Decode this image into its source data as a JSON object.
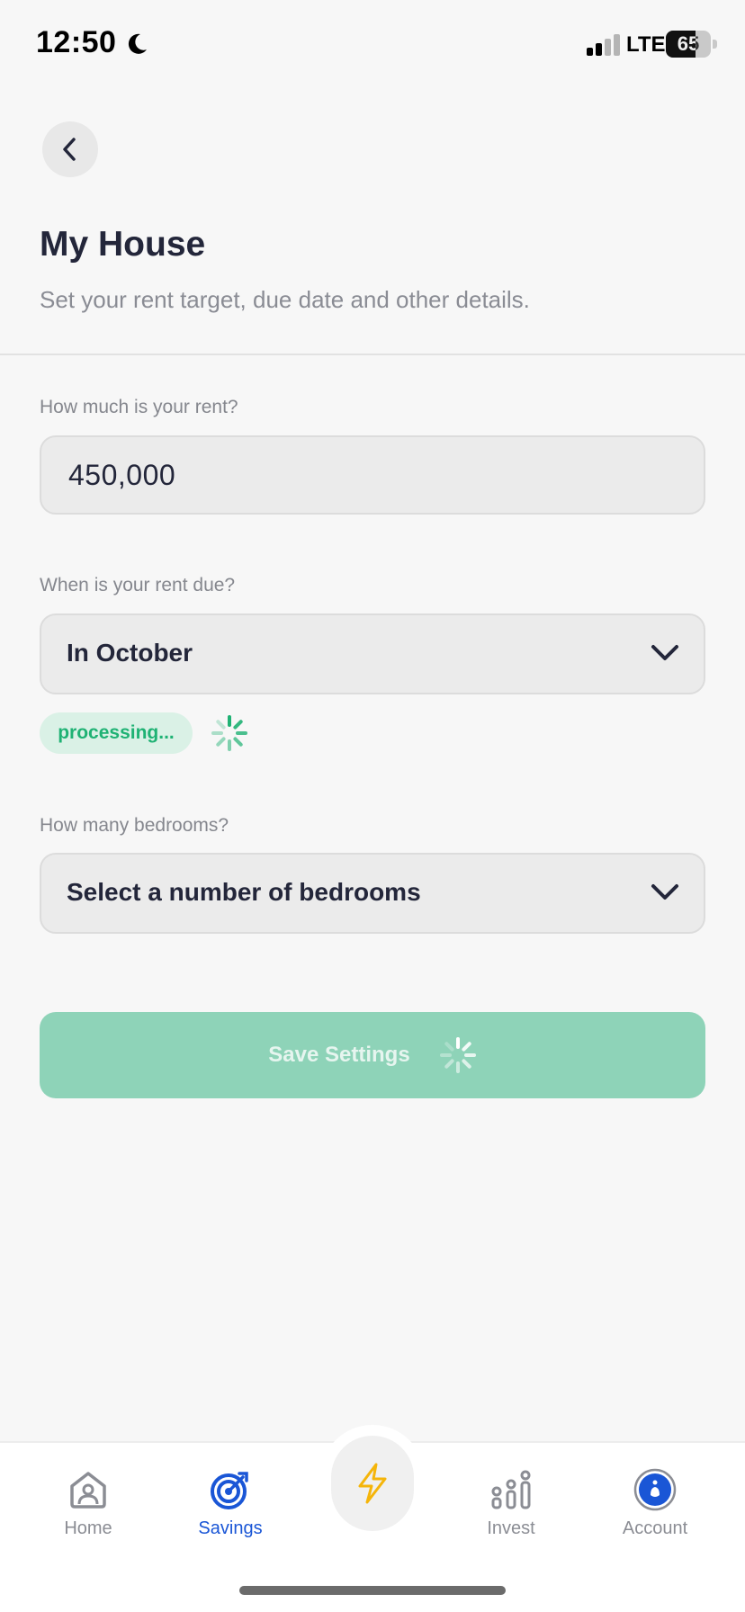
{
  "status_bar": {
    "time": "12:50",
    "network": "LTE",
    "battery": "65",
    "battery_level": 0.65
  },
  "header": {
    "back_icon": "chevron-left-icon",
    "title": "My House",
    "subtitle": "Set your rent target, due date and other details."
  },
  "form": {
    "rent": {
      "label": "How much is your rent?",
      "value": "450,000"
    },
    "due": {
      "label": "When is your rent due?",
      "value": "In October",
      "status": "processing..."
    },
    "bedrooms": {
      "label": "How many bedrooms?",
      "value": "Select a number of bedrooms"
    },
    "save_label": "Save Settings"
  },
  "nav": {
    "items": [
      {
        "label": "Home",
        "icon": "home-icon"
      },
      {
        "label": "Savings",
        "icon": "target-icon"
      },
      {
        "label": "Invest",
        "icon": "chart-icon"
      },
      {
        "label": "Account",
        "icon": "account-icon"
      }
    ],
    "center_icon": "lightning-icon"
  },
  "colors": {
    "accent_green": "#8ed3b8",
    "status_green": "#1fb274",
    "active_blue": "#1a56d6",
    "lightning_yellow": "#f5b50a"
  }
}
